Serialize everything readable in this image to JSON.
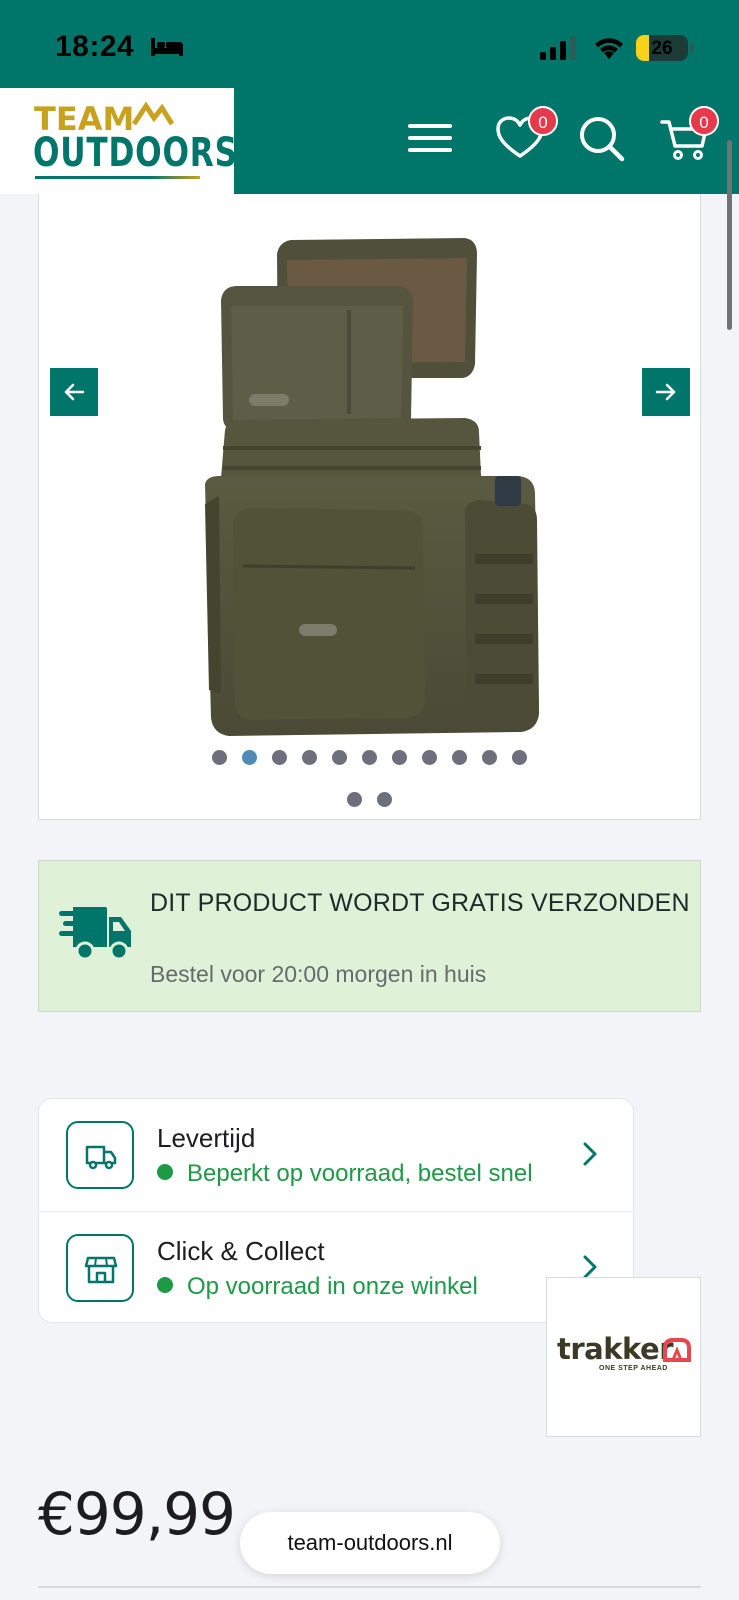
{
  "status_bar": {
    "time": "18:24",
    "focus_icon": "bed-icon",
    "battery": "26"
  },
  "header": {
    "logo_top": "TEAM",
    "logo_bottom": "OUTDOORS",
    "wishlist_count": "0",
    "cart_count": "0",
    "icons": [
      "menu-icon",
      "heart-icon",
      "search-icon",
      "cart-icon"
    ]
  },
  "gallery": {
    "dot_count_row1": 11,
    "dot_count_row2": 2,
    "active_dot": 2,
    "prev_icon": "arrow-left-icon",
    "next_icon": "arrow-right-icon"
  },
  "shipping": {
    "title": "DIT PRODUCT WORDT GRATIS VERZONDEN",
    "subtitle": "Bestel voor 20:00 morgen in huis"
  },
  "delivery": {
    "rows": [
      {
        "title": "Levertijd",
        "status": "Beperkt op voorraad, bestel snel"
      },
      {
        "title": "Click & Collect",
        "status": "Op voorraad in onze winkel"
      }
    ]
  },
  "brand": {
    "name": "trakker",
    "tagline": "ONE STEP AHEAD"
  },
  "price": "€99,99",
  "browser": {
    "url": "team-outdoors.nl"
  },
  "colors": {
    "brand_teal": "#00766a",
    "brand_gold": "#c8a21f",
    "badge_red": "#e6394a",
    "stock_green": "#1e9a47",
    "shipping_bg": "#dff2d8"
  }
}
